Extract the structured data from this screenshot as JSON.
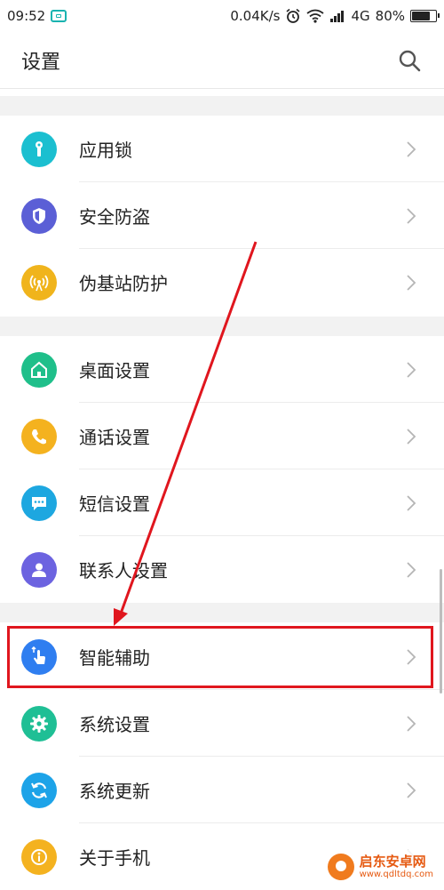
{
  "status_bar": {
    "time": "09:52",
    "net_speed": "0.04K/s",
    "network": "4G",
    "battery": "80%",
    "battery_level": 0.8
  },
  "app_bar": {
    "title": "设置",
    "search_icon": "search-icon"
  },
  "sections": [
    [
      {
        "label": "应用锁",
        "icon": "lock-key-icon",
        "color": "#1bbfd0"
      },
      {
        "label": "安全防盗",
        "icon": "shield-icon",
        "color": "#5b5fd6"
      },
      {
        "label": "伪基站防护",
        "icon": "signal-tower-icon",
        "color": "#f0b41c"
      }
    ],
    [
      {
        "label": "桌面设置",
        "icon": "home-icon",
        "color": "#1fbf8a"
      },
      {
        "label": "通话设置",
        "icon": "phone-icon",
        "color": "#f4b21f"
      },
      {
        "label": "短信设置",
        "icon": "message-icon",
        "color": "#1da7e0"
      },
      {
        "label": "联系人设置",
        "icon": "contact-icon",
        "color": "#6c63e0"
      }
    ],
    [
      {
        "label": "智能辅助",
        "icon": "hand-pointer-icon",
        "color": "#2f7ef0"
      },
      {
        "label": "系统设置",
        "icon": "gear-icon",
        "color": "#1fbf95"
      },
      {
        "label": "系统更新",
        "icon": "refresh-icon",
        "color": "#1da3e8"
      },
      {
        "label": "关于手机",
        "icon": "info-icon",
        "color": "#f4b21f"
      }
    ]
  ],
  "annotation": {
    "highlight_color": "#e0161e"
  },
  "watermark": {
    "title": "启东安卓网",
    "url": "www.qdltdq.com"
  }
}
